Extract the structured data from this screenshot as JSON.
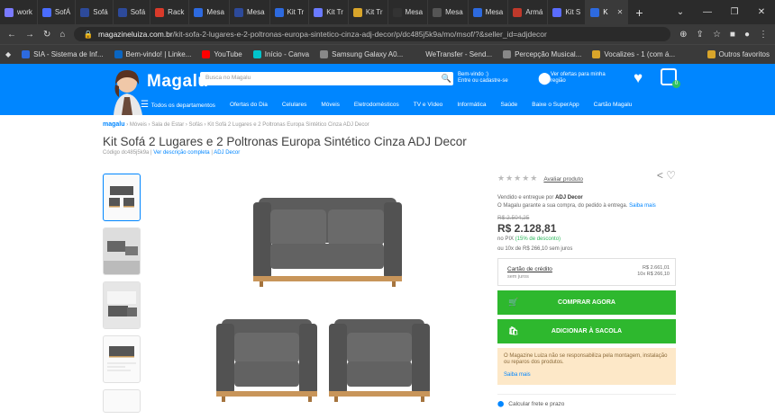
{
  "browser": {
    "tabs": [
      {
        "label": "work",
        "color": "#7a7aff"
      },
      {
        "label": "SofÁ",
        "color": "#4a6cff"
      },
      {
        "label": "Sofá",
        "color": "#2d4a9a"
      },
      {
        "label": "Sofá",
        "color": "#2d4a9a"
      },
      {
        "label": "Rack",
        "color": "#d93a2a"
      },
      {
        "label": "Mesa",
        "color": "#2d6adf"
      },
      {
        "label": "Mesa",
        "color": "#2d4a9a"
      },
      {
        "label": "Kit Tr",
        "color": "#2d6adf"
      },
      {
        "label": "Kit Tr",
        "color": "#6a7aff"
      },
      {
        "label": "Kit Tr",
        "color": "#d9a52a"
      },
      {
        "label": "Mesa",
        "color": "#333"
      },
      {
        "label": "Mesa",
        "color": "#555"
      },
      {
        "label": "Mesa",
        "color": "#2d6adf"
      },
      {
        "label": "Armá",
        "color": "#c0392b"
      },
      {
        "label": "Kit S",
        "color": "#5a6cff"
      },
      {
        "label": "K",
        "color": "#2d6adf"
      }
    ],
    "url_host": "magazineluiza.com.br",
    "url_path": "/kit-sofa-2-lugares-e-2-poltronas-europa-sintetico-cinza-adj-decor/p/dc485j5k9a/mo/msof/?&seller_id=adjdecor",
    "bookmarks": [
      {
        "label": "SIA - Sistema de Inf...",
        "color": "#2d6adf"
      },
      {
        "label": "Bem-vindo! | Linke...",
        "color": "#0a66c2"
      },
      {
        "label": "YouTube",
        "color": "#ff0000"
      },
      {
        "label": "Início - Canva",
        "color": "#00c4cc"
      },
      {
        "label": "Samsung Galaxy A0...",
        "color": "#888"
      },
      {
        "label": "WeTransfer - Send...",
        "color": "#3a3a3a"
      },
      {
        "label": "Percepção Musical...",
        "color": "#888"
      },
      {
        "label": "Vocalizes - 1 (com á...",
        "color": "#d9a52a"
      },
      {
        "label": "Outros favoritos",
        "color": "#d9a52a"
      }
    ]
  },
  "header": {
    "logo": "Magalu",
    "search_placeholder": "Busca no Magalu",
    "welcome_line1": "Bem-vindo :)",
    "welcome_line2": "Entre ou cadastre-se",
    "cep_line1": "Ver ofertas para minha",
    "cep_line2": "região",
    "bag_count": "0",
    "nav": [
      "Todos os departamentos",
      "Ofertas do Dia",
      "Celulares",
      "Móveis",
      "Eletrodomésticos",
      "TV e Vídeo",
      "Informática",
      "Saúde",
      "Baixe o SuperApp",
      "Cartão Magalu"
    ]
  },
  "product": {
    "breadcrumb_home": "magalu",
    "breadcrumb": "›  Móveis  ›  Sala de Estar  ›  Sofás  ›  Kit Sofá 2 Lugares e 2 Poltronas Europa Sintético Cinza ADJ Decor",
    "title": "Kit Sofá 2 Lugares e 2 Poltronas Europa Sintético Cinza ADJ Decor",
    "code": "Código dc485j5k9a",
    "desc_link": "Ver descrição completa",
    "brand": "ADJ Decor",
    "rate_label": "Avaliar produto",
    "sold_by_prefix": "Vendido e entregue por",
    "seller": "ADJ Decor",
    "guarantee": "O Magalu garante a sua compra, do pedido à entrega.",
    "guarantee_link": "Saiba mais",
    "old_price": "R$ 2.504,25",
    "price": "R$ 2.128,81",
    "pix_prefix": "no PIX",
    "pix_discount": "(15% de desconto)",
    "installments": "ou 10x de R$ 266,10 sem juros",
    "card_title": "Cartão de crédito",
    "card_sub": "sem juros",
    "card_right1": "R$ 2.661,01",
    "card_right2": "10x R$ 266,10",
    "buy_now": "COMPRAR AGORA",
    "add_bag": "ADICIONAR À SACOLA",
    "warning": "O Magazine Luiza não se responsabiliza pela montagem, instalação ou reparos dos produtos.",
    "warning_link": "Saiba mais",
    "shipping": "Calcular frete e prazo"
  }
}
